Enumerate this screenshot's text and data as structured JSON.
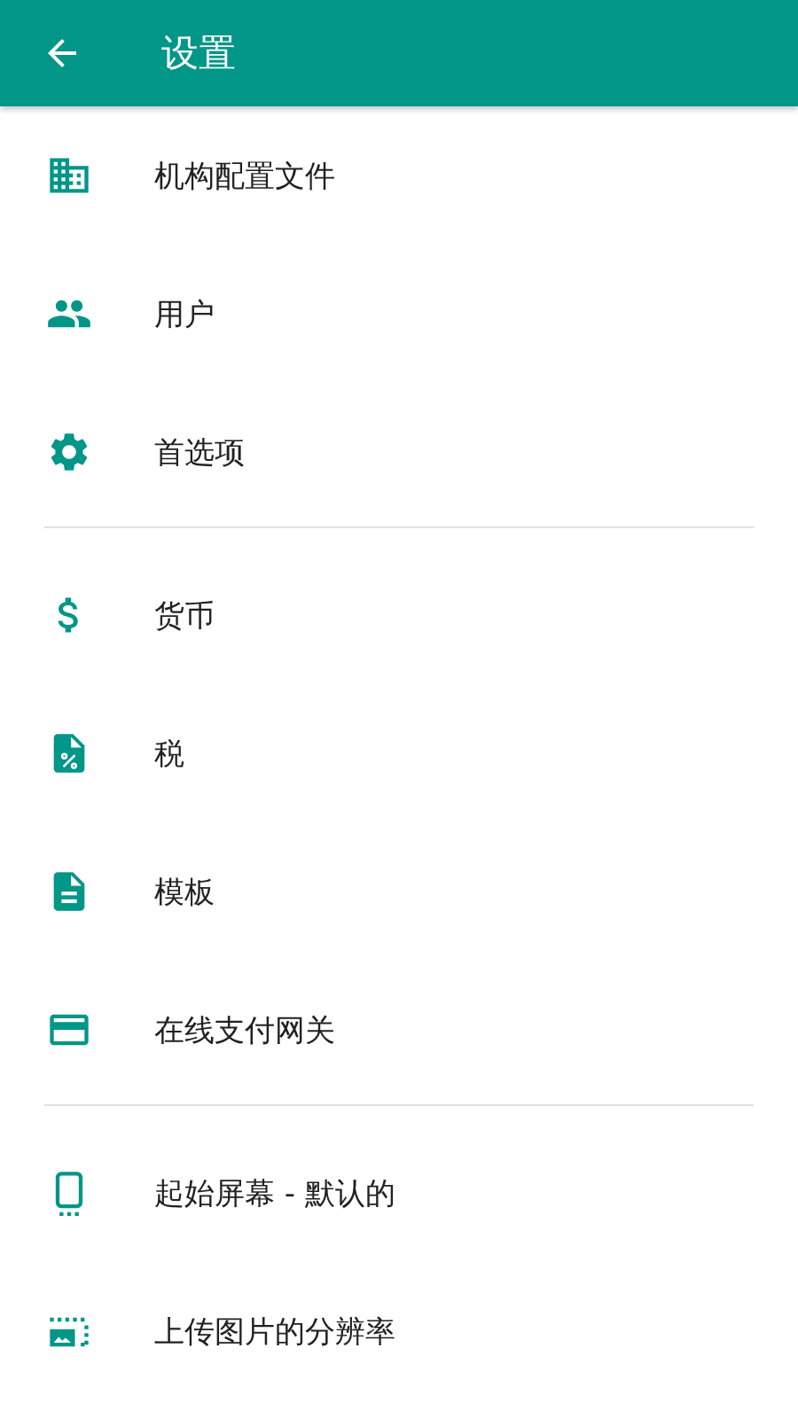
{
  "app_bar": {
    "title": "设置"
  },
  "sections": [
    {
      "items": [
        {
          "label": "机构配置文件"
        },
        {
          "label": "用户"
        },
        {
          "label": "首选项"
        }
      ]
    },
    {
      "items": [
        {
          "label": "货币"
        },
        {
          "label": "税"
        },
        {
          "label": "模板"
        },
        {
          "label": "在线支付网关"
        }
      ]
    },
    {
      "items": [
        {
          "label": "起始屏幕 - 默认的"
        },
        {
          "label": "上传图片的分辨率"
        }
      ]
    }
  ]
}
